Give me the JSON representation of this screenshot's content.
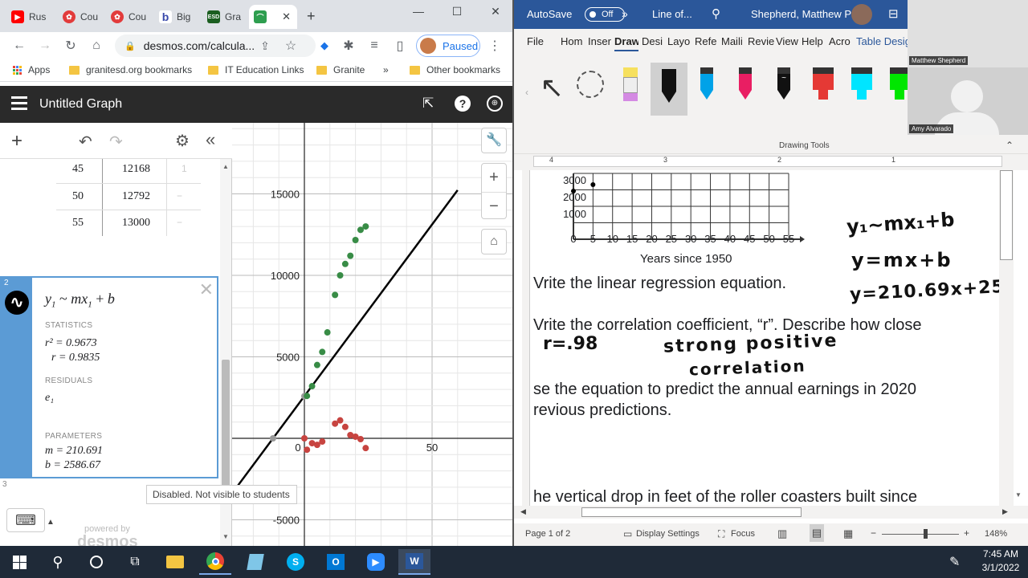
{
  "chrome": {
    "tabs": [
      {
        "label": "Rus",
        "color": "#ff0000"
      },
      {
        "label": "Cou",
        "color": "#e23b3b"
      },
      {
        "label": "Cou",
        "color": "#e23b3b"
      },
      {
        "label": "Big",
        "color": "#3949ab"
      },
      {
        "label": "Gra",
        "color": "#2e7d32"
      },
      {
        "label": "",
        "color": "#2e9e4f",
        "active": true
      }
    ],
    "url": "desmos.com/calcula...",
    "profile_status": "Paused",
    "bookmarks": [
      "Apps",
      "granitesd.org bookmarks",
      "IT Education Links",
      "Granite",
      "Other bookmarks"
    ],
    "bookmarks_overflow": "»"
  },
  "desmos": {
    "title": "Untitled Graph",
    "table_rows": [
      {
        "x": "45",
        "y": "12168",
        "r": "1"
      },
      {
        "x": "50",
        "y": "12792",
        "r": "−"
      },
      {
        "x": "55",
        "y": "13000",
        "r": "−"
      }
    ],
    "expr_index": "2",
    "next_index": "3",
    "expr_parts": {
      "y": "y",
      "sub": "1",
      "mid": " ~ ",
      "m": "m",
      "x": "x",
      "sub2": "1",
      "end": " + ",
      "b": "b"
    },
    "statistics_label": "STATISTICS",
    "r2": "r² = 0.9673",
    "r": "r = 0.9835",
    "residuals_label": "RESIDUALS",
    "residual": "e₁",
    "parameters_label": "PARAMETERS",
    "m": "m = 210.691",
    "b": "b = 2586.67",
    "tooltip": "Disabled. Not visible to students",
    "powered_by": "powered by",
    "brand": "desmos",
    "y_ticks": [
      "15000",
      "10000",
      "5000",
      "-5000"
    ],
    "x_ticks": [
      "0",
      "50"
    ]
  },
  "graph_data": {
    "green_points": [
      [
        1,
        2600
      ],
      [
        3,
        3200
      ],
      [
        5,
        4500
      ],
      [
        7,
        5300
      ],
      [
        9,
        6500
      ],
      [
        12,
        8800
      ],
      [
        14,
        10000
      ],
      [
        16,
        10700
      ],
      [
        18,
        11200
      ],
      [
        20,
        12168
      ],
      [
        22,
        12792
      ],
      [
        24,
        13000
      ]
    ],
    "red_points": [
      [
        0,
        0
      ],
      [
        1,
        -700
      ],
      [
        3,
        -300
      ],
      [
        5,
        -400
      ],
      [
        7,
        -200
      ],
      [
        12,
        900
      ],
      [
        14,
        1100
      ],
      [
        16,
        700
      ],
      [
        18,
        200
      ],
      [
        20,
        100
      ],
      [
        22,
        -50
      ],
      [
        24,
        -600
      ]
    ],
    "line": {
      "m": 210.691,
      "b": 2586.67
    }
  },
  "word": {
    "autosave": "AutoSave",
    "autosave_state": "Off",
    "doc_title": "Line of...",
    "user": "Shepherd, Matthew P",
    "tabs": [
      "File",
      "Hom",
      "Inser",
      "Draw",
      "Desi",
      "Layo",
      "Refe",
      "Maili",
      "Revie",
      "View",
      "Help",
      "Acro",
      "Table Design"
    ],
    "group_label": "Drawing Tools",
    "ruler": [
      "4",
      "3",
      "2",
      "1"
    ],
    "chart_y": [
      "3000",
      "2000",
      "1000"
    ],
    "chart_x": [
      "0",
      "5",
      "10",
      "15",
      "20",
      "25",
      "30",
      "35",
      "40",
      "45",
      "50",
      "55"
    ],
    "chart_xlabel": "Years since 1950",
    "q1": "Vrite the linear regression equation.",
    "q2": "Vrite the correlation coefficient, “r”. Describe how close",
    "q3": "se the equation to predict the annual earnings in 2020",
    "q3b": "revious predictions.",
    "q4": "he vertical drop in feet of the roller coasters built since",
    "hw1": "y₁~mx₁+b",
    "hw2": "y=mx+b",
    "hw3": "y=210.69x+25",
    "hw4": "r=.98",
    "hw5": "strong positive",
    "hw6": "correlation",
    "status_page": "Page 1 of 2",
    "display_settings": "Display Settings",
    "focus": "Focus",
    "zoom": "148%"
  },
  "video": {
    "top_name": "Matthew Shepherd",
    "bottom_name": "Amy Alvarado"
  },
  "taskbar": {
    "time": "7:45 AM",
    "date": "3/1/2022"
  }
}
